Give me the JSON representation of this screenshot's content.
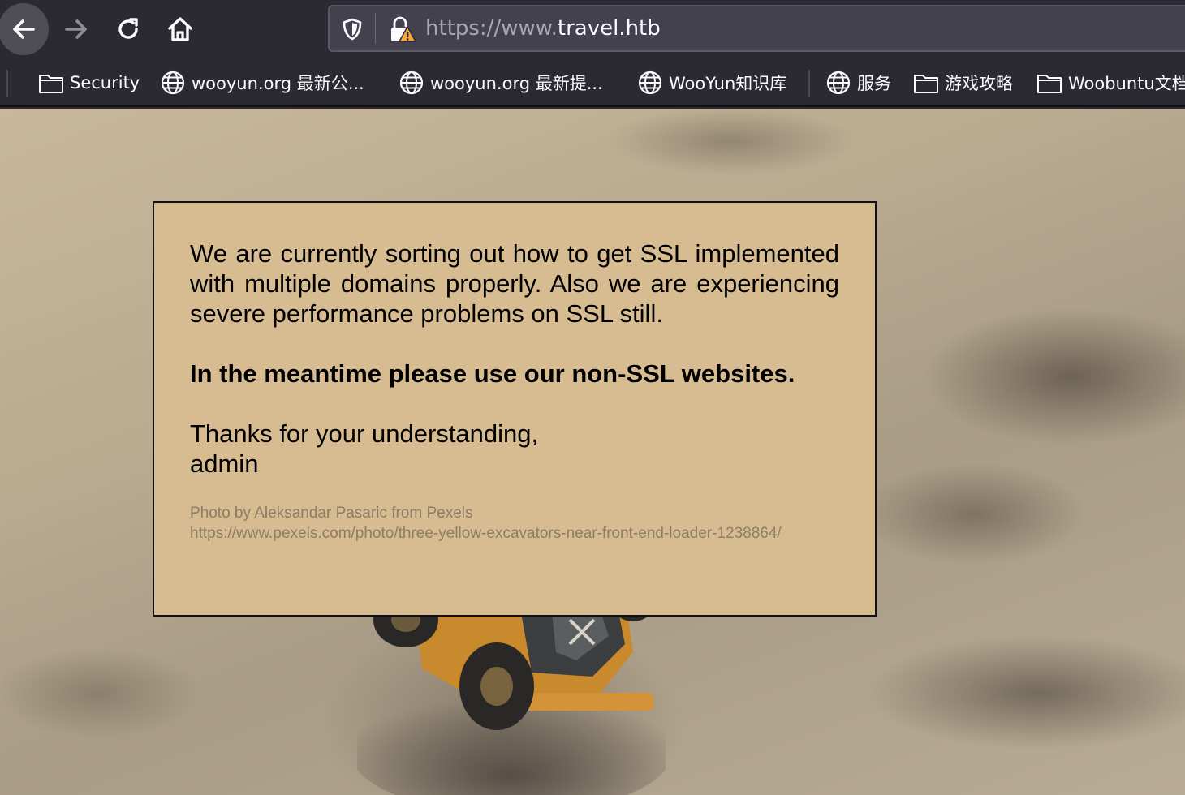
{
  "browser": {
    "url_scheme": "https://www.",
    "url_host": "travel.htb"
  },
  "bookmarks": [
    {
      "icon": "folder-icon",
      "label": "Security"
    },
    {
      "icon": "globe-icon",
      "label": "wooyun.org 最新公..."
    },
    {
      "icon": "globe-icon",
      "label": "wooyun.org 最新提..."
    },
    {
      "icon": "globe-icon",
      "label": "WooYun知识库"
    },
    {
      "icon": "globe-icon",
      "label": "服务"
    },
    {
      "icon": "folder-icon",
      "label": "游戏攻略"
    },
    {
      "icon": "folder-icon",
      "label": "Woobuntu文档"
    }
  ],
  "notice": {
    "message": "We are currently sorting out how to get SSL implemented with multiple domains properly. Also we are experiencing severe performance problems on SSL still.",
    "emphasis": "In the meantime please use our non-SSL websites.",
    "thanks": "Thanks for your understanding,",
    "signature": "admin",
    "credit_line": "Photo by Aleksandar Pasaric from Pexels",
    "credit_url": "https://www.pexels.com/photo/three-yellow-excavators-near-front-end-loader-1238864/"
  },
  "colors": {
    "chrome_bg": "#2b2a33",
    "urlbar_bg": "#42414d",
    "notice_bg": "#d7bc92",
    "credit_text": "#8c7d66",
    "warning_yellow": "#ffa436"
  }
}
